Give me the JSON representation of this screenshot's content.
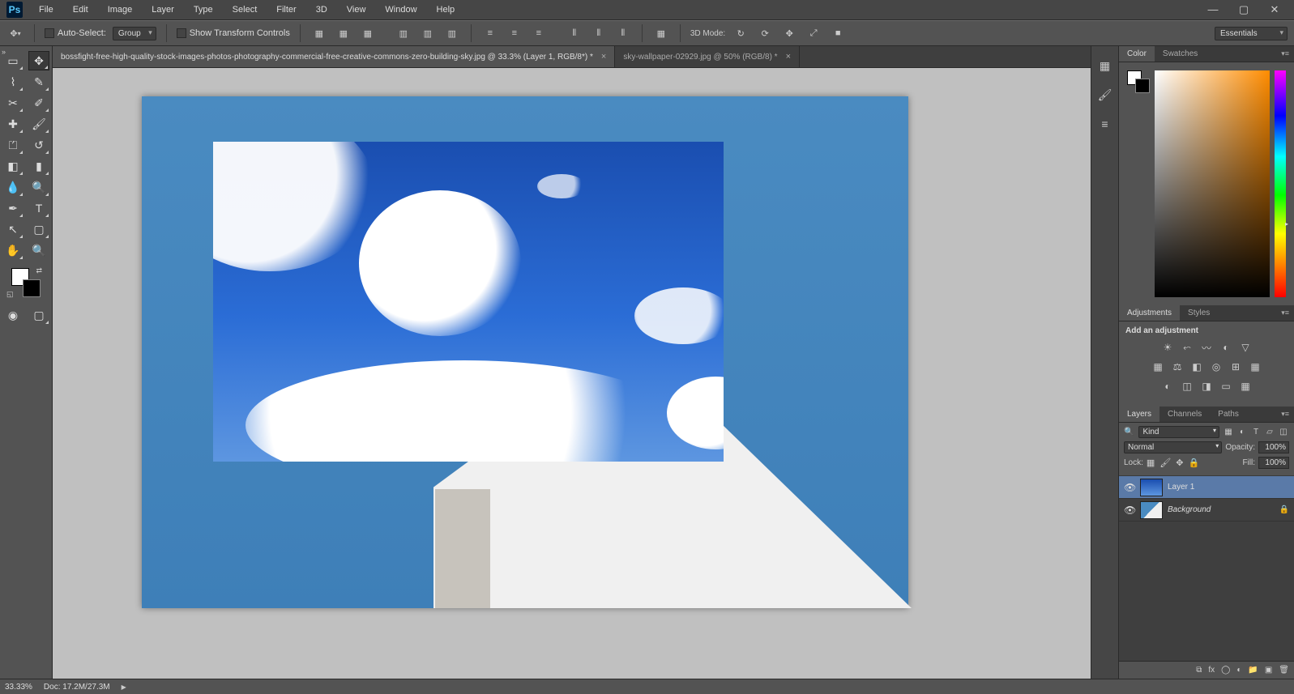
{
  "menu": {
    "items": [
      "File",
      "Edit",
      "Image",
      "Layer",
      "Type",
      "Select",
      "Filter",
      "3D",
      "View",
      "Window",
      "Help"
    ]
  },
  "options": {
    "autoselect_label": "Auto-Select:",
    "autoselect_dropdown": "Group",
    "show_transform": "Show Transform Controls",
    "d3_mode": "3D Mode:"
  },
  "workspace": {
    "current": "Essentials"
  },
  "documents": {
    "tabs": [
      {
        "title": "bossfight-free-high-quality-stock-images-photos-photography-commercial-free-creative-commons-zero-building-sky.jpg @ 33.3% (Layer 1, RGB/8*) *",
        "active": true
      },
      {
        "title": "sky-wallpaper-02929.jpg @ 50% (RGB/8) *",
        "active": false
      }
    ]
  },
  "panels": {
    "color_tabs": [
      "Color",
      "Swatches"
    ],
    "adj_tabs": [
      "Adjustments",
      "Styles"
    ],
    "adj_title": "Add an adjustment",
    "layers_tabs": [
      "Layers",
      "Channels",
      "Paths"
    ],
    "layers": {
      "filter_kind": "Kind",
      "blend_mode": "Normal",
      "opacity_label": "Opacity:",
      "opacity_value": "100%",
      "lock_label": "Lock:",
      "fill_label": "Fill:",
      "fill_value": "100%",
      "items": [
        {
          "name": "Layer 1",
          "locked": false,
          "active": true,
          "italic": false
        },
        {
          "name": "Background",
          "locked": true,
          "active": false,
          "italic": true
        }
      ]
    }
  },
  "status": {
    "zoom": "33.33%",
    "doc_label": "Doc:",
    "doc_size": "17.2M/27.3M"
  }
}
